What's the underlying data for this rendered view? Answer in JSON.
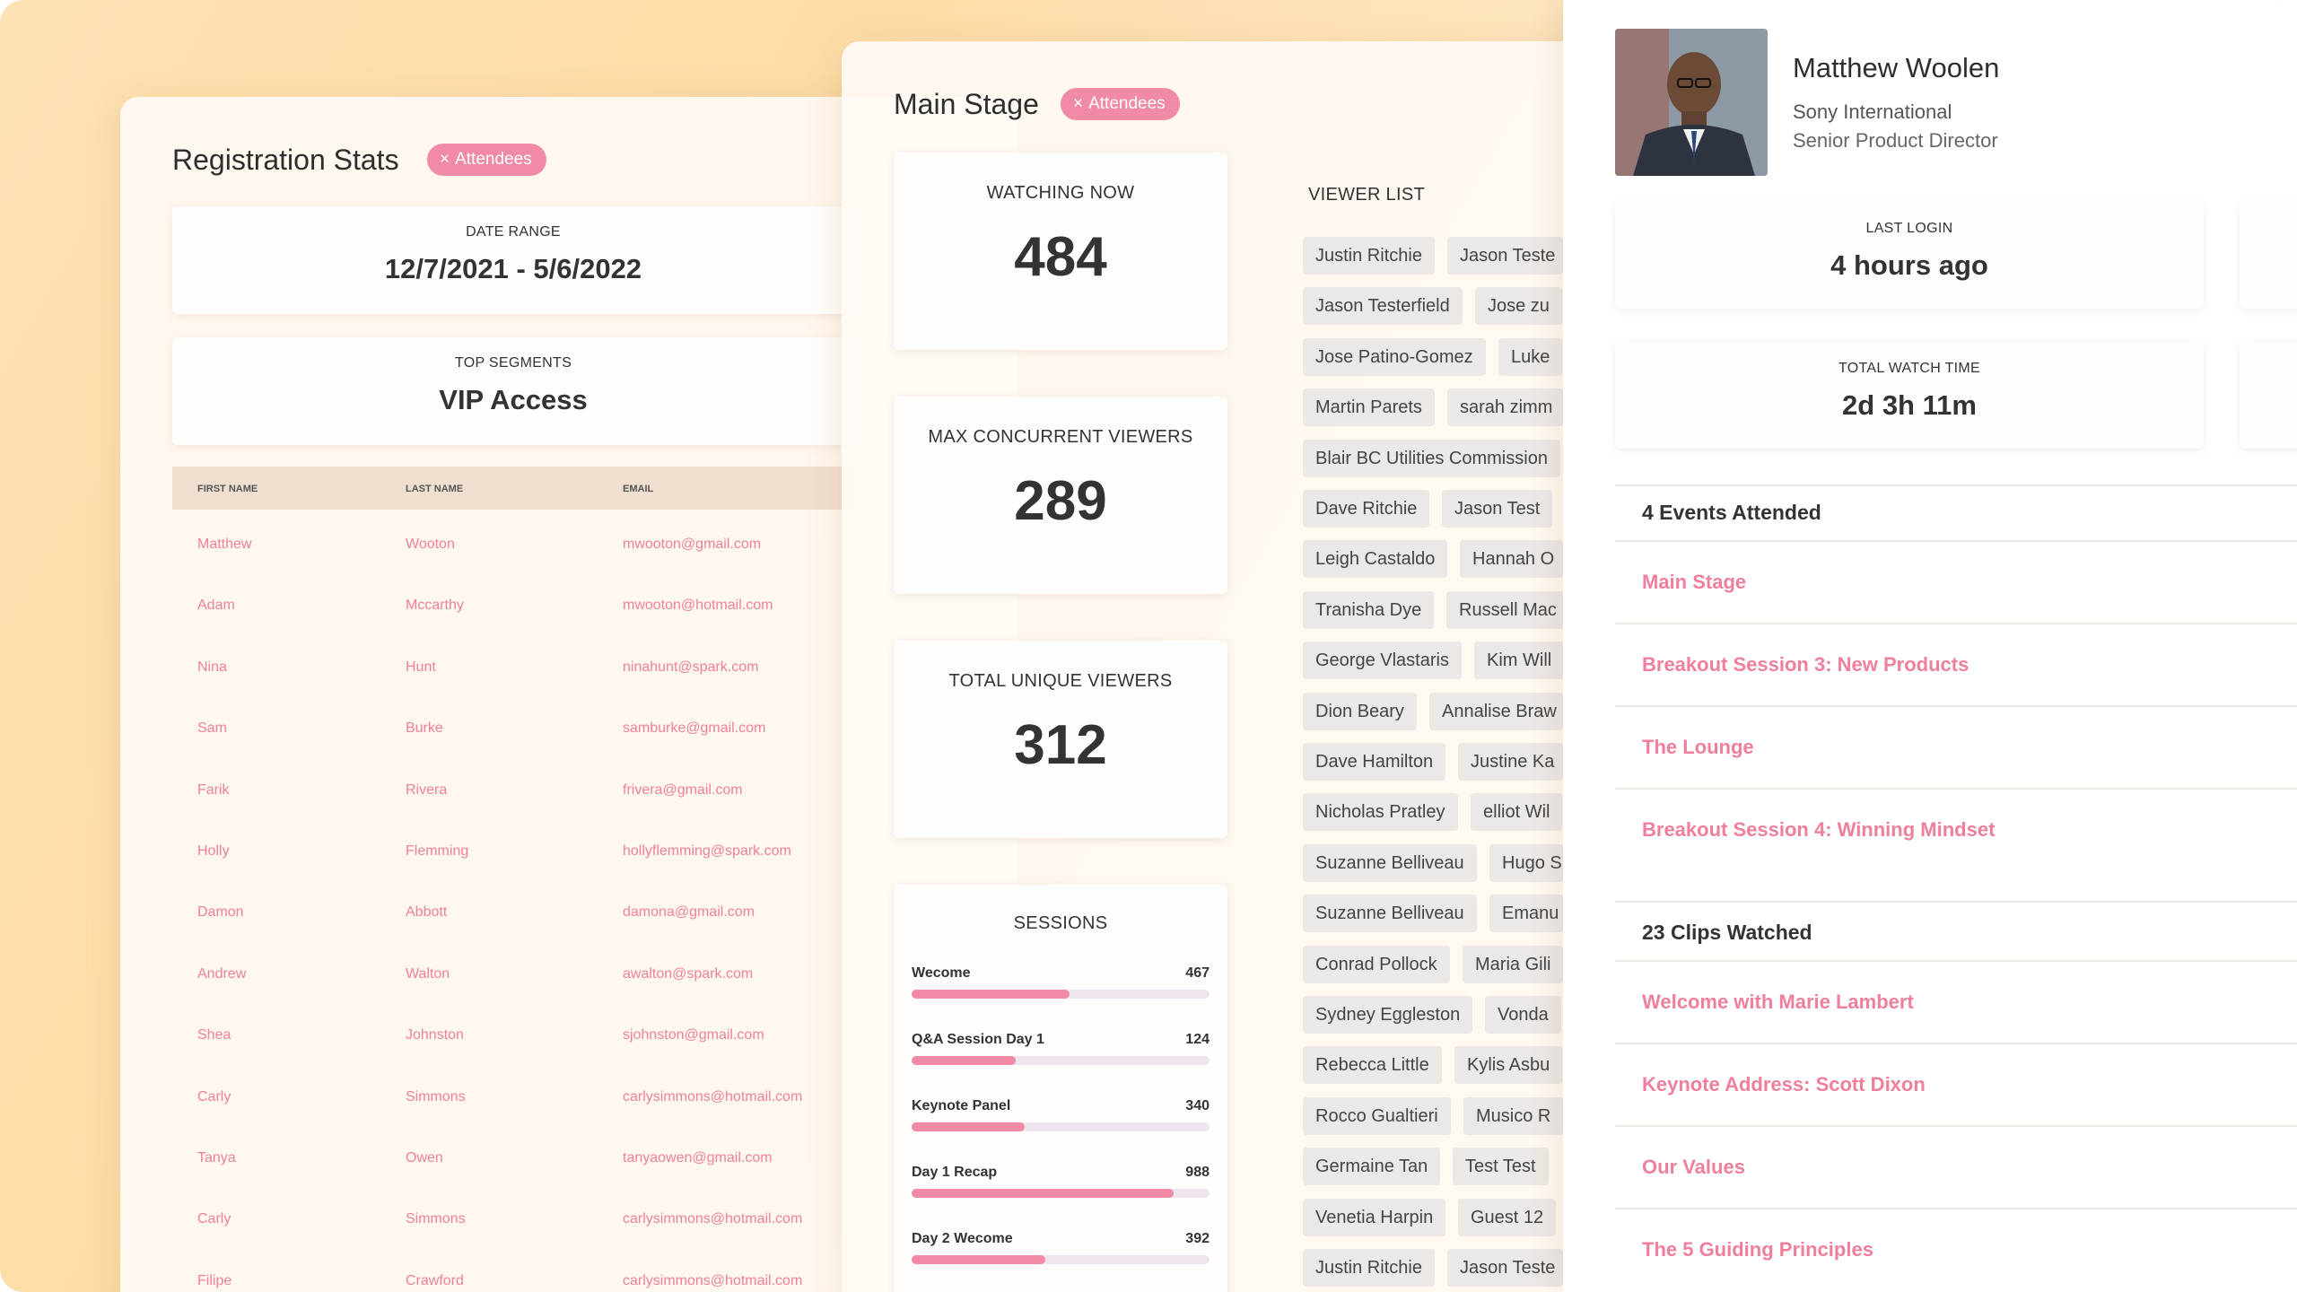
{
  "registration": {
    "title": "Registration Stats",
    "chip": "Attendees",
    "date_range_label": "DATE RANGE",
    "date_range_value": "12/7/2021 - 5/6/2022",
    "top_segments_label": "TOP SEGMENTS",
    "top_segments_value": "VIP Access",
    "columns": [
      "FIRST NAME",
      "LAST NAME",
      "EMAIL"
    ],
    "rows": [
      [
        "Matthew",
        "Wooton",
        "mwooton@gmail.com"
      ],
      [
        "Adam",
        "Mccarthy",
        "mwooton@hotmail.com"
      ],
      [
        "Nina",
        "Hunt",
        "ninahunt@spark.com"
      ],
      [
        "Sam",
        "Burke",
        "samburke@gmail.com"
      ],
      [
        "Farik",
        "Rivera",
        "frivera@gmail.com"
      ],
      [
        "Holly",
        "Flemming",
        "hollyflemming@spark.com"
      ],
      [
        "Damon",
        "Abbott",
        "damona@gmail.com"
      ],
      [
        "Andrew",
        "Walton",
        "awalton@spark.com"
      ],
      [
        "Shea",
        "Johnston",
        "sjohnston@gmail.com"
      ],
      [
        "Carly",
        "Simmons",
        "carlysimmons@hotmail.com"
      ],
      [
        "Tanya",
        "Owen",
        "tanyaowen@gmail.com"
      ],
      [
        "Carly",
        "Simmons",
        "carlysimmons@hotmail.com"
      ],
      [
        "Filipe",
        "Crawford",
        "carlysimmons@hotmail.com"
      ]
    ]
  },
  "main_stage": {
    "title": "Main Stage",
    "chip": "Attendees",
    "watching_now_label": "WATCHING NOW",
    "watching_now_value": "484",
    "max_concurrent_label": "MAX CONCURRENT VIEWERS",
    "max_concurrent_value": "289",
    "total_unique_label": "TOTAL UNIQUE VIEWERS",
    "total_unique_value": "312",
    "sessions_label": "SESSIONS",
    "sessions": [
      {
        "name": "Wecome",
        "value": "467",
        "fraction": 0.53
      },
      {
        "name": "Q&A Session Day 1",
        "value": "124",
        "fraction": 0.35
      },
      {
        "name": "Keynote Panel",
        "value": "340",
        "fraction": 0.38
      },
      {
        "name": "Day 1 Recap",
        "value": "988",
        "fraction": 0.88
      },
      {
        "name": "Day 2 Wecome",
        "value": "392",
        "fraction": 0.45
      }
    ],
    "viewer_list_label": "VIEWER LIST",
    "viewers": [
      [
        "Justin Ritchie",
        "Jason Teste"
      ],
      [
        "Jason Testerfield",
        "Jose zu"
      ],
      [
        "Jose Patino-Gomez",
        "Luke"
      ],
      [
        "Martin Parets",
        "sarah zimm"
      ],
      [
        "Blair BC Utilities Commission",
        ""
      ],
      [
        "Dave Ritchie",
        "Jason Test"
      ],
      [
        "Leigh Castaldo",
        "Hannah O"
      ],
      [
        "Tranisha Dye",
        "Russell Mac"
      ],
      [
        "George Vlastaris",
        "Kim Will"
      ],
      [
        "Dion Beary",
        "Annalise Braw"
      ],
      [
        "Dave Hamilton",
        "Justine Ka"
      ],
      [
        "Nicholas Pratley",
        "elliot Wil"
      ],
      [
        "Suzanne Belliveau",
        "Hugo S"
      ],
      [
        "Suzanne Belliveau",
        "Emanu"
      ],
      [
        "Conrad Pollock",
        "Maria Gili"
      ],
      [
        "Sydney Eggleston",
        "Vonda"
      ],
      [
        "Rebecca Little",
        "Kylis Asbu"
      ],
      [
        "Rocco Gualtieri",
        "Musico R"
      ],
      [
        "Germaine Tan",
        "Test Test"
      ],
      [
        "Venetia Harpin",
        "Guest 12"
      ],
      [
        "Justin Ritchie",
        "Jason Teste"
      ]
    ]
  },
  "profile": {
    "name": "Matthew Woolen",
    "company": "Sony International",
    "role": "Senior Product Director",
    "last_login_label": "LAST LOGIN",
    "last_login_value": "4 hours ago",
    "watch_time_label": "TOTAL WATCH TIME",
    "watch_time_value": "2d 3h 11m",
    "events_heading": "4 Events Attended",
    "events": [
      "Main Stage",
      "Breakout Session 3: New Products",
      "The Lounge",
      "Breakout Session 4: Winning Mindset"
    ],
    "clips_heading": "23 Clips Watched",
    "clips": [
      "Welcome with Marie Lambert",
      "Keynote Address: Scott Dixon",
      "Our Values",
      "The 5 Guiding Principles"
    ]
  },
  "colors": {
    "accent": "#f08aa6",
    "background_warm": "#fde2b3"
  }
}
